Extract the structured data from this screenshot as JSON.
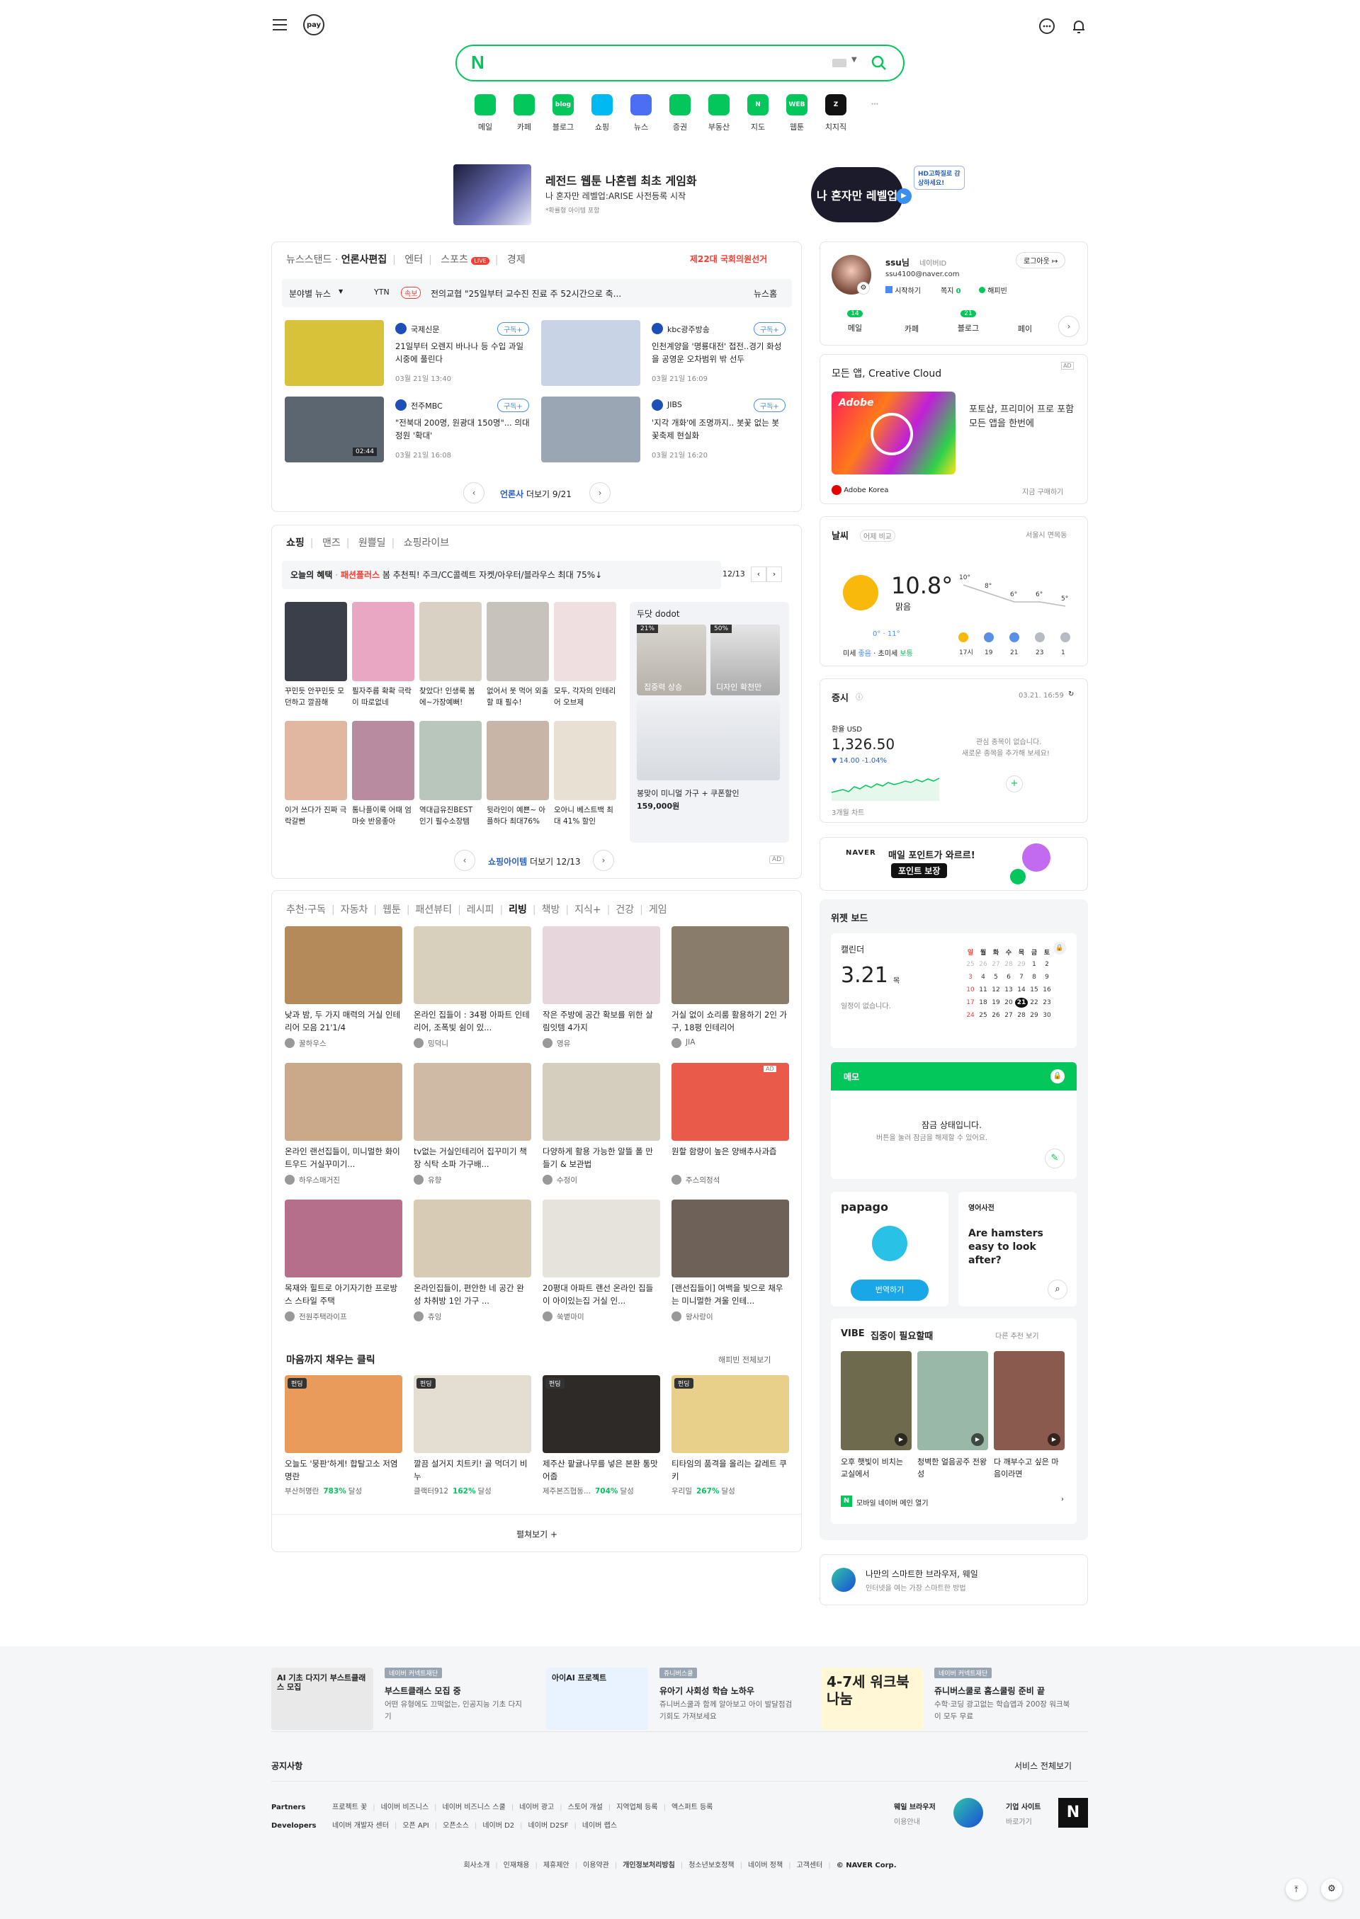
{
  "colors": {
    "brand": "#03c75a",
    "accent_red": "#ff3b30",
    "accent_blue": "#4a8cf5"
  },
  "header": {
    "menu_icon": "hamburger-icon",
    "pay_label": "pay",
    "chat_icon": "chat-icon",
    "bell_icon": "bell-icon"
  },
  "search": {
    "logo": "N",
    "placeholder": ""
  },
  "shortcuts": [
    {
      "label": "메일",
      "icon": "mail-icon",
      "color": "#03c75a"
    },
    {
      "label": "카페",
      "icon": "cafe-icon",
      "color": "#03c75a"
    },
    {
      "label": "블로그",
      "icon": "blog-icon",
      "color": "#03c75a",
      "text": "blog"
    },
    {
      "label": "쇼핑",
      "icon": "shopping-icon",
      "color": "#00b9f2"
    },
    {
      "label": "뉴스",
      "icon": "news-icon",
      "color": "#4c6ef5"
    },
    {
      "label": "증권",
      "icon": "stock-icon",
      "color": "#03c75a"
    },
    {
      "label": "부동산",
      "icon": "realestate-icon",
      "color": "#03c75a"
    },
    {
      "label": "지도",
      "icon": "map-icon",
      "color": "#03c75a",
      "text": "N"
    },
    {
      "label": "웹툰",
      "icon": "webtoon-icon",
      "color": "#03c75a",
      "text": "WEB"
    },
    {
      "label": "치지직",
      "icon": "chzzk-icon",
      "color": "#111",
      "text": "Z"
    },
    {
      "label": "",
      "icon": "more-icon",
      "color": "#aaa",
      "text": "···"
    }
  ],
  "banner": {
    "title": "레전드 웹툰 나혼렙 최초 게임화",
    "subtitle": "나 혼자만 레벨업:ARISE 사전등록 시작",
    "fine": "*확률형 아이템 포함",
    "bubble": "HD고화질로 감상하세요!",
    "logo_text": "나 혼자만 레벨업"
  },
  "news": {
    "tabs": [
      "뉴스스탠드",
      "언론사편집",
      "엔터",
      "스포츠",
      "경제"
    ],
    "live": "LIVE",
    "election": "제22대 국회의원선거",
    "ticker_filter": "분야별 뉴스",
    "ticker_source": "YTN",
    "ticker_badge": "속보",
    "ticker_text": "전의교협 \"25일부터 교수진 진료 주 52시간으로 축...",
    "ticker_right": "뉴스홈",
    "subscribe": "구독+",
    "items": [
      {
        "press": "국제신문",
        "title": "21일부터 오렌지 바나나 등 수입 과일 시중에 풀린다",
        "date": "03월 21일 13:40",
        "img": "#d8c23a"
      },
      {
        "press": "kbc광주방송",
        "title": "인천계양을 '명룡대전' 접전..경기 화성을 공영운 오차범위 밖 선두",
        "date": "03월 21일 16:09",
        "img": "#c9d3e6"
      },
      {
        "press": "전주MBC",
        "title": "\"전북대 200명, 원광대 150명\"... 의대 정원 '확대'",
        "date": "03월 21일 16:08",
        "img": "#5c6670",
        "badge": "02:44"
      },
      {
        "press": "JIBS",
        "title": "'지각 개화'에 조명까지.. 봇꽃 없는 봇꽃축제 현실화",
        "date": "03월 21일 16:20",
        "img": "#9aa6b4"
      }
    ],
    "pager": {
      "press": "언론사",
      "more": "더보기",
      "page": "9/21"
    }
  },
  "shopping": {
    "tabs": [
      "쇼핑",
      "맨즈",
      "원쁠딜",
      "쇼핑라이브"
    ],
    "benefit_label": "오늘의 혜택",
    "benefit_brand": "패션플러스",
    "benefit_text": "봄 추천픽! 주크/CC콜렉트 자켓/아우터/블라우스 최대 75%↓",
    "benefit_page": "12/13",
    "items": [
      {
        "title": "꾸민듯 안꾸민듯 모던하고 깔끔해",
        "img": "#3b3f4a"
      },
      {
        "title": "필자주름 확확 극락이 따로없네",
        "img": "#e9a7c4"
      },
      {
        "title": "찾았다! 인생룩 봄에~가장예뻐!",
        "img": "#d9d2c4"
      },
      {
        "title": "없어서 못 먹어 외출할 때 필수!",
        "img": "#c8c2bd"
      },
      {
        "title": "모두, 각자의 인테리어 오브제",
        "img": "#f0dfe1"
      },
      {
        "title": "이거 쓰다가 진짜 극락갈뻔",
        "img": "#e2b7a2"
      },
      {
        "title": "통나플이룩 어때 엄마숏 반응좋아",
        "img": "#b98ba0"
      },
      {
        "title": "역대급유진BEST 인기 필수소장템",
        "img": "#b9c6bb"
      },
      {
        "title": "뒷라인이 예쁜~ 아플하다 최대76%",
        "img": "#c9b5a8"
      },
      {
        "title": "오아니 베스트백 최대 41% 할인",
        "img": "#e8e1d3"
      }
    ],
    "dodot": {
      "title": "두닷 dodot",
      "tags": [
        {
          "pct": "21%",
          "label": "집중력 상승"
        },
        {
          "pct": "50%",
          "label": "디자인 확천만"
        }
      ],
      "desc": "봉맞이 미니멀 가구 + 쿠폰할인",
      "price": "159,000원"
    },
    "pager": {
      "more_label": "쇼핑아이템",
      "more": "더보기",
      "page": "12/13",
      "ad": "AD"
    }
  },
  "feed": {
    "tabs": [
      "추천·구독",
      "자동차",
      "웹툰",
      "패션뷰티",
      "레시피",
      "리빙",
      "책방",
      "지식+",
      "건강",
      "게임"
    ],
    "active_tab": "리빙",
    "items": [
      {
        "title": "낮과 밤, 두 가지 매력의 거실 인테리어 모음 21'1/4",
        "author": "꿀하우스",
        "img": "#b58a5a"
      },
      {
        "title": "온라인 집들이 : 34평 아파트 인테리어, 조폭빛 쉼이 있...",
        "author": "밍덕니",
        "img": "#d8cfbd"
      },
      {
        "title": "작은 주방에 공간 확보를 위한 살림잇템 4가지",
        "author": "영유",
        "img": "#e7d6db"
      },
      {
        "title": "거실 없이 쇼리룸 활용하기 2인 가구, 18평 인테리어",
        "author": "JIA",
        "img": "#8a7c6a"
      },
      {
        "title": "온라인 랜선집들이, 미니멀한 화이트우드 거실꾸미기...",
        "author": "하우스매거진",
        "img": "#c9a98a"
      },
      {
        "title": "tv없는 거실인테리어 집꾸미기 책장 식탁 소파 가구배...",
        "author": "유향",
        "img": "#cfbba5"
      },
      {
        "title": "다양하게 활용 가능한 알뜰 폴 만들기 & 보관법",
        "author": "수정이",
        "img": "#d5cdbd"
      },
      {
        "title": "원할 함량이 높은 양배추사과즙",
        "author": "주스의정석",
        "img": "#e95a4a",
        "ad": "AD"
      },
      {
        "title": "목재와 힐트로 아기자기한 프로방스 스타일 주택",
        "author": "전원주택라이프",
        "img": "#b56f8a"
      },
      {
        "title": "온라인집들이, 편안한 네 공간 완성 차취방 1인 가구 ...",
        "author": "츄잉",
        "img": "#d8cbb5"
      },
      {
        "title": "20평대 아파트 랜선 온라인 집들이 아이있는집 거실 인...",
        "author": "쑥볕마미",
        "img": "#e6e2dc"
      },
      {
        "title": "[랜선집들이] 여백을 빛으로 채우는 미니멀한 겨울 인테...",
        "author": "왕사랑이",
        "img": "#6e6258"
      }
    ],
    "funding": {
      "title": "마음까지 채우는 클릭",
      "more": "해피빈 전체보기",
      "items": [
        {
          "badge": "펀딩",
          "title": "오늘도 '뭉판'하게! 합탈고소 저염 명란",
          "org": "부산허명란",
          "pct": "783%",
          "done": "달성",
          "img": "#e89b5a"
        },
        {
          "badge": "펀딩",
          "title": "깔끔 설거지 치트키! 골 먹더기 비누",
          "org": "클랙터912",
          "pct": "162%",
          "done": "달성",
          "img": "#e3ddd2"
        },
        {
          "badge": "펀딩",
          "title": "제주산 팥귤나무를 넣은 본환 통맛어줍",
          "org": "제주본즈협동...",
          "pct": "704%",
          "done": "달성",
          "img": "#2d2a28"
        },
        {
          "badge": "펀딩",
          "title": "티타임의 품격을 올리는 갈레트 쿠키",
          "org": "우리밀",
          "pct": "267%",
          "done": "달성",
          "img": "#e8cf8a"
        }
      ]
    },
    "expand": "펼쳐보기 +"
  },
  "profile": {
    "name": "ssu님",
    "id_label": "네이버ID",
    "email": "ssu4100@naver.com",
    "logout": "로그아웃",
    "start": "시작하기",
    "notes": "쪽지",
    "notes_count": "0",
    "happybean": "해피빈",
    "tabs": [
      {
        "label": "메일",
        "count": "14"
      },
      {
        "label": "카페",
        "count": ""
      },
      {
        "label": "블로그",
        "count": "21"
      },
      {
        "label": "페이",
        "count": ""
      }
    ]
  },
  "ad_cc": {
    "title": "모든 앱, Creative Cloud",
    "ad": "AD",
    "brand": "Adobe",
    "desc": "포토샵, 프리미어 프로 포함 모든 앱을 한번에",
    "company": "Adobe Korea",
    "cta": "지금 구매하기"
  },
  "weather": {
    "title": "날씨",
    "compare": "어제 비교",
    "location": "서울시 면목동",
    "temp": "10.8°",
    "condition": "맑음",
    "range": "0° · 11°",
    "dust": "미세",
    "dust_v": "좋음",
    "ultra": "초미세",
    "ultra_v": "보통",
    "hours": [
      "17시",
      "19",
      "21",
      "23",
      "1"
    ],
    "temps": [
      "10°",
      "8°",
      "6°",
      "6°",
      "5°"
    ]
  },
  "stocks": {
    "title": "증시",
    "time": "03.21. 16:59",
    "fx_label": "환율 USD",
    "fx_value": "1,326.50",
    "fx_change": "▼ 14.00 -1.04%",
    "chart_label": "3개월 차트",
    "empty1": "관심 종목이 없습니다.",
    "empty2": "새로운 종목을 추가해 보세요!"
  },
  "promo": {
    "brand": "NAVER",
    "line1": "매일 포인트가 와르르!",
    "line2": "포인트 보장"
  },
  "widget": {
    "title": "위젯 보드",
    "calendar": {
      "title": "캘린더",
      "date": "3.21",
      "weekday": "목",
      "empty": "일정이 없습니다.",
      "days": [
        "일",
        "월",
        "화",
        "수",
        "목",
        "금",
        "토"
      ],
      "rows": [
        [
          "25",
          "26",
          "27",
          "28",
          "29",
          "1",
          "2"
        ],
        [
          "3",
          "4",
          "5",
          "6",
          "7",
          "8",
          "9"
        ],
        [
          "10",
          "11",
          "12",
          "13",
          "14",
          "15",
          "16"
        ],
        [
          "17",
          "18",
          "19",
          "20",
          "21",
          "22",
          "23"
        ],
        [
          "24",
          "25",
          "26",
          "27",
          "28",
          "29",
          "30"
        ]
      ],
      "today": "21"
    },
    "memo": {
      "title": "메모",
      "locked": "잠금 상태입니다.",
      "hint": "버튼을 눌러 잠금을 해제할 수 있어요."
    },
    "papago": {
      "logo": "papago",
      "cta": "번역하기"
    },
    "dict": {
      "title": "영어사전",
      "text": "Are hamsters easy to look after?"
    },
    "vibe": {
      "logo": "VIBE",
      "title": "집중이 필요할때",
      "more": "다른 추천 보기",
      "items": [
        {
          "title": "오후 햇빛이 비치는 교실에서",
          "img": "#6d6a4e"
        },
        {
          "title": "청벽한 얼음공주 전왕성",
          "img": "#9ab8a8"
        },
        {
          "title": "다 깨부수고 싶은 마음이라면",
          "img": "#8a5a4e"
        }
      ]
    },
    "mobile": "모바일 네이버 메인 열기"
  },
  "whale": {
    "title": "나만의 스마트한 브라우저, 웨일",
    "desc": "인터넷을 여는 가장 스마트한 방법"
  },
  "footer": {
    "promos": [
      {
        "img_title": "AI 기초 다지기 부스트클래스 모집",
        "tag": "네이버 커넥트재단",
        "title": "부스트클래스 모집 중",
        "desc": "어떤 유형에도 끄떡없는, 인공지능 기초 다지기"
      },
      {
        "img_title": "아이AI 프로젝트",
        "tag": "쥬니버스쿨",
        "title": "유아기 사회성 학습 노하우",
        "desc": "쥬니버스쿨과 함께 알아보고 아이 발달점검 기회도 가져보세요"
      },
      {
        "img_title": "4-7세 워크북 나눔",
        "tag": "네이버 커넥트재단",
        "title": "쥬니버스쿨로 홈스쿨링 준비 끝",
        "desc": "수학·코딩 광고없는 학습앱과 200장 워크북이 모두 무료"
      }
    ],
    "notice": "공지사항",
    "services": "서비스 전체보기",
    "partners_label": "Partners",
    "partners": [
      "프로젝트 꽃",
      "네이버 비즈니스",
      "네이버 비즈니스 스쿨",
      "네이버 광고",
      "스토어 개설",
      "지역업체 등록",
      "엑스퍼트 등록"
    ],
    "dev_label": "Developers",
    "devs": [
      "네이버 개발자 센터",
      "오픈 API",
      "오픈소스",
      "네이버 D2",
      "네이버 D2SF",
      "네이버 랩스"
    ],
    "whale_label": "웨일 브라우저",
    "whale_sub": "이용안내",
    "corp_label": "기업 사이트",
    "corp_sub": "바로가기",
    "links": [
      "회사소개",
      "인재채용",
      "제휴제안",
      "이용약관",
      "개인정보처리방침",
      "청소년보호정책",
      "네이버 정책",
      "고객센터"
    ],
    "copyright": "© NAVER Corp."
  }
}
